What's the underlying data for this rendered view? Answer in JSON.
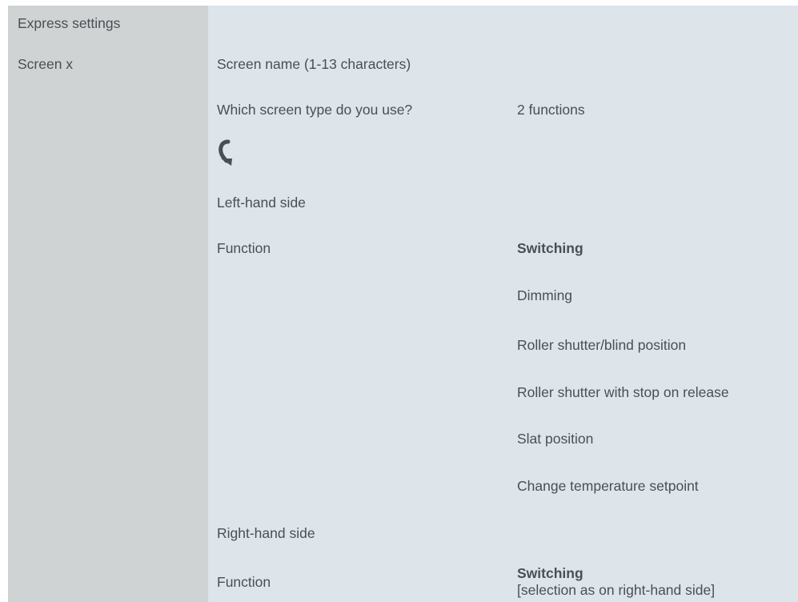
{
  "sidebar": {
    "items": [
      {
        "label": "Express settings"
      },
      {
        "label": "Screen x"
      }
    ]
  },
  "main": {
    "screen_name_label": "Screen name (1-13 characters)",
    "screen_type_label": "Which screen type do you use?",
    "screen_type_value": "2 functions",
    "arrow_icon": "curved-arrow-icon",
    "left_side": {
      "heading": "Left-hand side",
      "function_label": "Function",
      "options": [
        {
          "label": "Switching",
          "selected": true
        },
        {
          "label": "Dimming",
          "selected": false
        },
        {
          "label": "Roller shutter/blind position",
          "selected": false
        },
        {
          "label": "Roller shutter with stop on release",
          "selected": false
        },
        {
          "label": "Slat position",
          "selected": false
        },
        {
          "label": "Change temperature setpoint",
          "selected": false
        }
      ]
    },
    "right_side": {
      "heading": "Right-hand side",
      "function_label": "Function",
      "value": "Switching",
      "note": "[selection as on right-hand side]"
    }
  },
  "colors": {
    "sidebar_bg": "#cfd3d3",
    "main_bg": "#dde4ea",
    "text": "#4a4f55"
  }
}
